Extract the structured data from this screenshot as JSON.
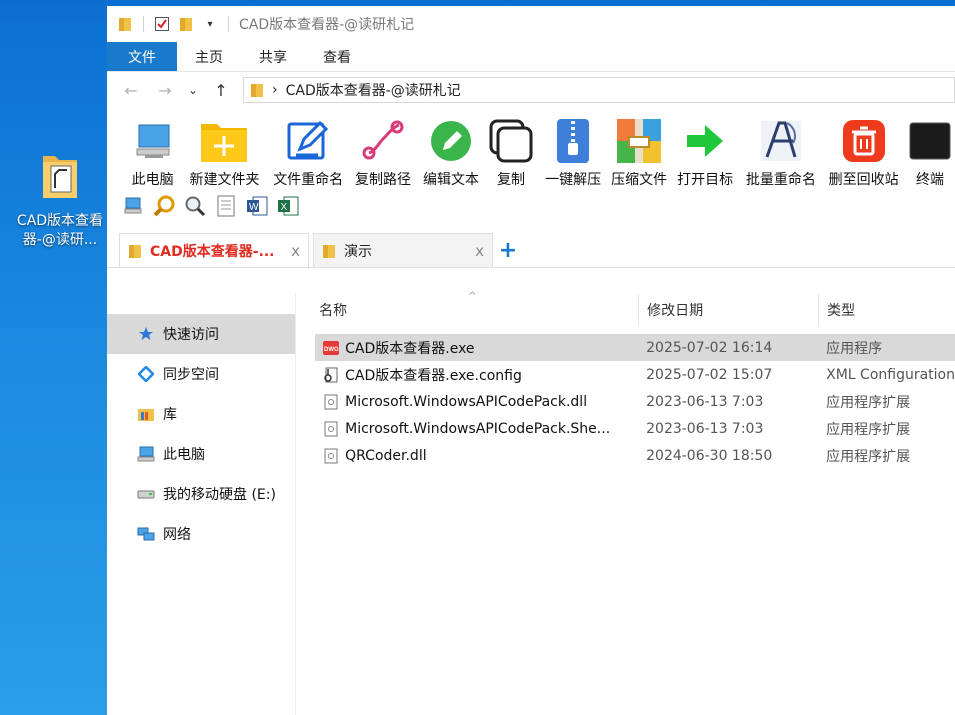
{
  "desktop": {
    "icon_label": "CAD版本查看器-@读研..."
  },
  "window": {
    "title": "CAD版本查看器-@读研札记"
  },
  "ribbon": {
    "tabs": [
      "文件",
      "主页",
      "共享",
      "查看"
    ]
  },
  "address": {
    "path": "CAD版本查看器-@读研札记",
    "sep": "›"
  },
  "toolbar": {
    "tools": [
      {
        "label": "此电脑",
        "icon": "computer-icon"
      },
      {
        "label": "新建文件夹",
        "icon": "new-folder-icon"
      },
      {
        "label": "文件重命名",
        "icon": "rename-icon"
      },
      {
        "label": "复制路径",
        "icon": "path-icon"
      },
      {
        "label": "编辑文本",
        "icon": "edit-text-icon"
      },
      {
        "label": "复制",
        "icon": "copy-icon"
      },
      {
        "label": "一键解压",
        "icon": "unzip-icon"
      },
      {
        "label": "压缩文件",
        "icon": "zip-icon"
      },
      {
        "label": "打开目标",
        "icon": "open-target-icon"
      },
      {
        "label": "批量重命名",
        "icon": "batch-rename-icon"
      },
      {
        "label": "删至回收站",
        "icon": "recycle-icon"
      },
      {
        "label": "终端",
        "icon": "terminal-icon"
      }
    ]
  },
  "tabs": [
    {
      "label": "CAD版本查看器-...",
      "close": "x"
    },
    {
      "label": "演示",
      "close": "x"
    }
  ],
  "new_tab": "+",
  "nav": [
    {
      "label": "快速访问",
      "icon": "star-icon"
    },
    {
      "label": "同步空间",
      "icon": "sync-icon"
    },
    {
      "label": "库",
      "icon": "library-icon"
    },
    {
      "label": "此电脑",
      "icon": "computer-icon"
    },
    {
      "label": "我的移动硬盘 (E:)",
      "icon": "drive-icon"
    },
    {
      "label": "网络",
      "icon": "network-icon"
    }
  ],
  "columns": {
    "name": "名称",
    "date": "修改日期",
    "type": "类型"
  },
  "files": [
    {
      "name": "CAD版本查看器.exe",
      "date": "2025-07-02 16:14",
      "type": "应用程序",
      "icon": "dwg-exe-icon"
    },
    {
      "name": "CAD版本查看器.exe.config",
      "date": "2025-07-02 15:07",
      "type": "XML Configuration",
      "icon": "config-file-icon"
    },
    {
      "name": "Microsoft.WindowsAPICodePack.dll",
      "date": "2023-06-13 7:03",
      "type": "应用程序扩展",
      "icon": "dll-file-icon"
    },
    {
      "name": "Microsoft.WindowsAPICodePack.She...",
      "date": "2023-06-13 7:03",
      "type": "应用程序扩展",
      "icon": "dll-file-icon"
    },
    {
      "name": "QRCoder.dll",
      "date": "2024-06-30 18:50",
      "type": "应用程序扩展",
      "icon": "dll-file-icon"
    }
  ],
  "colors": {
    "accent": "#1979ca",
    "active_tab_text": "#e02b20",
    "selection": "#d9d9d9"
  }
}
